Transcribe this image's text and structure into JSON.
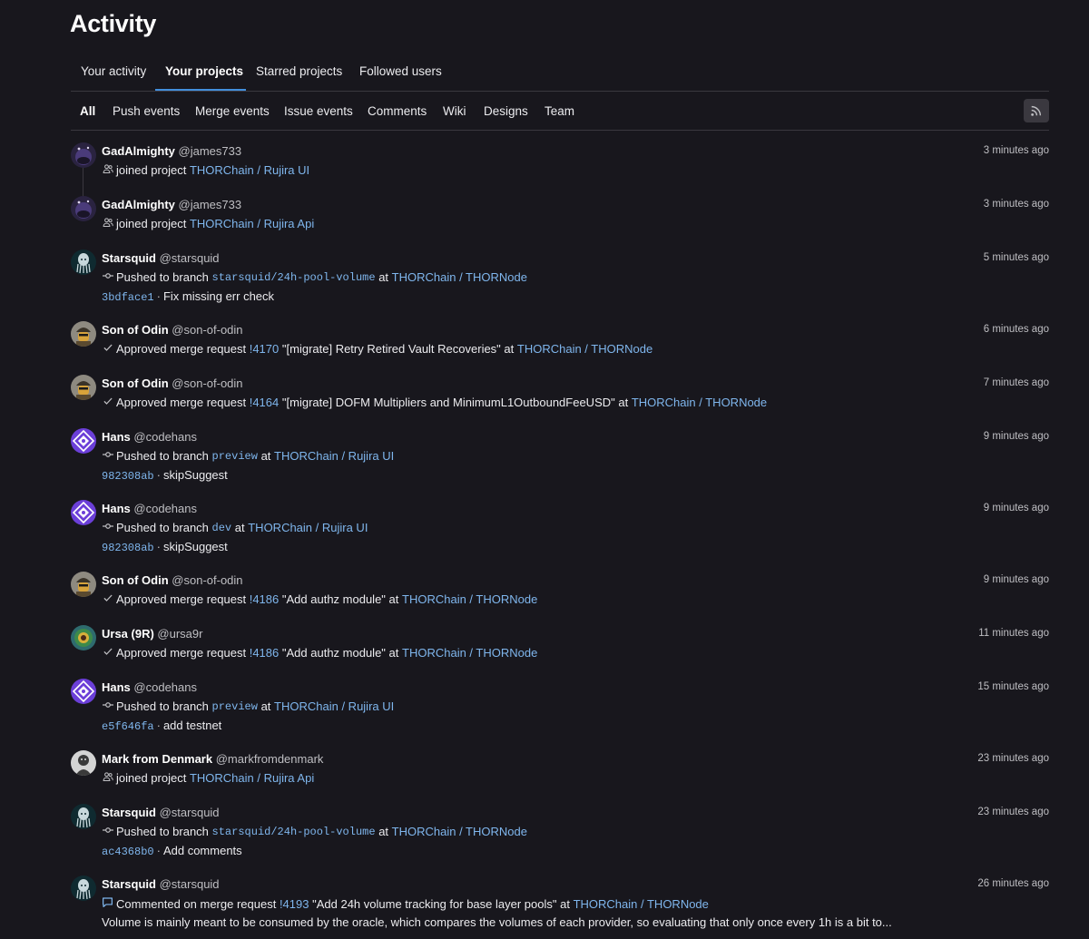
{
  "page_title": "Activity",
  "tabs": [
    {
      "label": "Your activity",
      "active": false
    },
    {
      "label": "Your projects",
      "active": true
    },
    {
      "label": "Starred projects",
      "active": false
    },
    {
      "label": "Followed users",
      "active": false
    }
  ],
  "filters": [
    {
      "label": "All",
      "active": true
    },
    {
      "label": "Push events",
      "active": false
    },
    {
      "label": "Merge events",
      "active": false
    },
    {
      "label": "Issue events",
      "active": false
    },
    {
      "label": "Comments",
      "active": false
    },
    {
      "label": "Wiki",
      "active": false
    },
    {
      "label": "Designs",
      "active": false
    },
    {
      "label": "Team",
      "active": false
    }
  ],
  "rss_icon": "rss-icon",
  "colors": {
    "link": "#7fb6ed",
    "tab_underline": "#428fdc",
    "background": "#18171d"
  },
  "events": [
    {
      "name": "GadAlmighty",
      "handle": "@james733",
      "time": "3 minutes ago",
      "avatar": "gad",
      "icon": "users-icon",
      "action": "joined project",
      "project": "THORChain / Rujira UI"
    },
    {
      "name": "GadAlmighty",
      "handle": "@james733",
      "time": "3 minutes ago",
      "avatar": "gad",
      "icon": "users-icon",
      "action": "joined project",
      "project": "THORChain / Rujira Api"
    },
    {
      "name": "Starsquid",
      "handle": "@starsquid",
      "time": "5 minutes ago",
      "avatar": "squid",
      "icon": "commit-icon",
      "action": "Pushed to branch",
      "branch": "starsquid/24h-pool-volume",
      "at": "at",
      "project": "THORChain / THORNode",
      "sha": "3bdface1",
      "sep": "·",
      "message": "Fix missing err check"
    },
    {
      "name": "Son of Odin",
      "handle": "@son-of-odin",
      "time": "6 minutes ago",
      "avatar": "odin",
      "icon": "check-icon",
      "action": "Approved merge request",
      "mr": "!4170",
      "mr_title": "\"[migrate] Retry Retired Vault Recoveries\"",
      "at": "at",
      "project": "THORChain / THORNode"
    },
    {
      "name": "Son of Odin",
      "handle": "@son-of-odin",
      "time": "7 minutes ago",
      "avatar": "odin",
      "icon": "check-icon",
      "action": "Approved merge request",
      "mr": "!4164",
      "mr_title": "\"[migrate] DOFM Multipliers and MinimumL1OutboundFeeUSD\"",
      "at": "at",
      "project": "THORChain / THORNode"
    },
    {
      "name": "Hans",
      "handle": "@codehans",
      "time": "9 minutes ago",
      "avatar": "hans",
      "icon": "commit-icon",
      "action": "Pushed to branch",
      "branch": "preview",
      "at": "at",
      "project": "THORChain / Rujira UI",
      "sha": "982308ab",
      "sep": "·",
      "message": "skipSuggest"
    },
    {
      "name": "Hans",
      "handle": "@codehans",
      "time": "9 minutes ago",
      "avatar": "hans",
      "icon": "commit-icon",
      "action": "Pushed to branch",
      "branch": "dev",
      "at": "at",
      "project": "THORChain / Rujira UI",
      "sha": "982308ab",
      "sep": "·",
      "message": "skipSuggest"
    },
    {
      "name": "Son of Odin",
      "handle": "@son-of-odin",
      "time": "9 minutes ago",
      "avatar": "odin",
      "icon": "check-icon",
      "action": "Approved merge request",
      "mr": "!4186",
      "mr_title": "\"Add authz module\"",
      "at": "at",
      "project": "THORChain / THORNode"
    },
    {
      "name": "Ursa (9R)",
      "handle": "@ursa9r",
      "time": "11 minutes ago",
      "avatar": "ursa",
      "icon": "check-icon",
      "action": "Approved merge request",
      "mr": "!4186",
      "mr_title": "\"Add authz module\"",
      "at": "at",
      "project": "THORChain / THORNode"
    },
    {
      "name": "Hans",
      "handle": "@codehans",
      "time": "15 minutes ago",
      "avatar": "hans",
      "icon": "commit-icon",
      "action": "Pushed to branch",
      "branch": "preview",
      "at": "at",
      "project": "THORChain / Rujira UI",
      "sha": "e5f646fa",
      "sep": "·",
      "message": "add testnet"
    },
    {
      "name": "Mark from Denmark",
      "handle": "@markfromdenmark",
      "time": "23 minutes ago",
      "avatar": "mark",
      "icon": "users-icon",
      "action": "joined project",
      "project": "THORChain / Rujira Api"
    },
    {
      "name": "Starsquid",
      "handle": "@starsquid",
      "time": "23 minutes ago",
      "avatar": "squid",
      "icon": "commit-icon",
      "action": "Pushed to branch",
      "branch": "starsquid/24h-pool-volume",
      "at": "at",
      "project": "THORChain / THORNode",
      "sha": "ac4368b0",
      "sep": "·",
      "message": "Add comments"
    },
    {
      "name": "Starsquid",
      "handle": "@starsquid",
      "time": "26 minutes ago",
      "avatar": "squid",
      "icon": "comment-icon",
      "action": "Commented on merge request",
      "mr": "!4193",
      "mr_title": "\"Add 24h volume tracking for base layer pools\"",
      "at": "at",
      "project": "THORChain / THORNode",
      "comment": "Volume is mainly meant to be consumed by the oracle, which compares the volumes of each provider, so evaluating that only once every 1h is a bit to..."
    }
  ]
}
